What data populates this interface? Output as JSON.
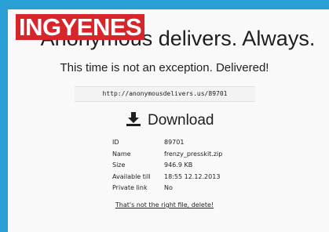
{
  "badge": "INGYENES",
  "headline": "Anonymous delivers. Always.",
  "subline": "This time is not an exception. Delivered!",
  "url": "http://anonymousdelivers.us/89701",
  "download_label": "Download",
  "info": [
    {
      "key": "ID",
      "value": "89701"
    },
    {
      "key": "Name",
      "value": "frenzy_presskit.zip"
    },
    {
      "key": "Size",
      "value": "946.9 KB"
    },
    {
      "key": "Available till",
      "value": "18:55 12.12.2013"
    },
    {
      "key": "Private link",
      "value": "No"
    }
  ],
  "delete_link": "That's not the right file, delete!",
  "colors": {
    "background": "#2a9fd6",
    "badge": "#d7262b",
    "panel": "#f9f9f9"
  }
}
